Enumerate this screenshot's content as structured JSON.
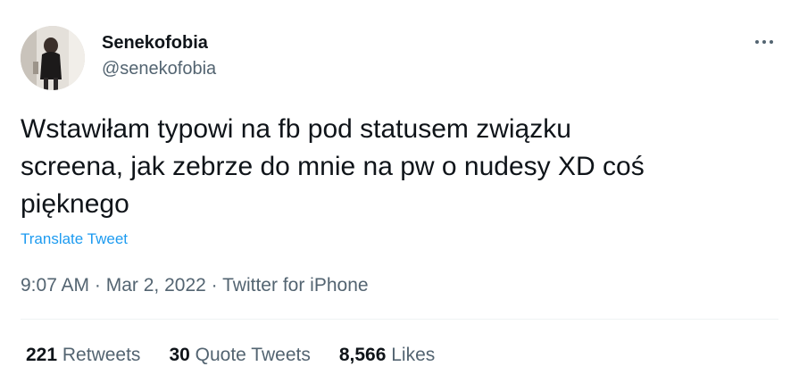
{
  "user": {
    "display_name": "Senekofobia",
    "handle": "@senekofobia"
  },
  "tweet": {
    "text": "Wstawiłam typowi na fb pod statusem związku\nscreena, jak zebrze do mnie na pw o nudesy XD coś\npięknego",
    "translate_label": "Translate Tweet",
    "time": "9:07 AM",
    "separator": "·",
    "date": "Mar 2, 2022",
    "source": "Twitter for iPhone"
  },
  "stats": {
    "retweets_count": "221",
    "retweets_label": "Retweets",
    "quotes_count": "30",
    "quotes_label": "Quote Tweets",
    "likes_count": "8,566",
    "likes_label": "Likes"
  },
  "icons": {
    "more": "more-horizontal-icon"
  },
  "colors": {
    "text_primary": "#0f1419",
    "text_secondary": "#536471",
    "link": "#1d9bf0",
    "divider": "#eff3f4"
  }
}
